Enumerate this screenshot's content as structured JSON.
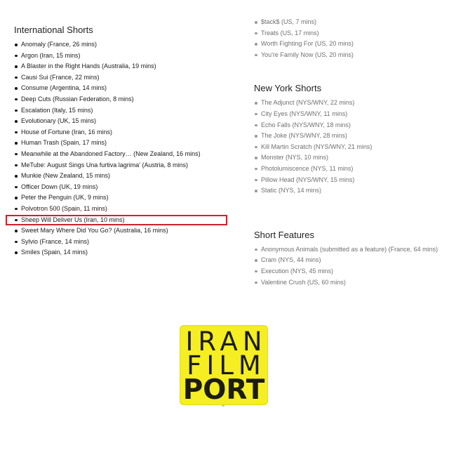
{
  "international": {
    "title": "International Shorts",
    "items": [
      "Anomaly (France, 26 mins)",
      "Argon (Iran, 15 mins)",
      "A Blaster in the Right Hands (Australia, 19 mins)",
      "Causi Sui (France, 22 mins)",
      "Consume (Argentina, 14 mins)",
      "Deep Cuts (Russian Federation, 8 mins)",
      "Escalation (Italy, 15 mins)",
      "Evolutionary (UK, 15 mins)",
      "House of Fortune (Iran, 16 mins)",
      "Human Trash (Spain, 17 mins)",
      "Meanwhile at the Abandoned Factory… (New Zealand, 16 mins)",
      "MeTube: August Sings Una furtiva lagrima' (Austria, 8 mins)",
      "Munkie (New Zealand, 15 mins)",
      "Officer Down (UK, 19 mins)",
      "Peter the Penguin (UK, 9 mins)",
      "Polvotron 500 (Spain, 11 mins)",
      "Sheep Will Deliver Us (Iran, 10 mins)",
      "Sweet Mary Where Did You Go? (Australia, 16 mins)",
      "Sylvio (France, 14 mins)",
      "Smiles  (Spain, 14 mins)"
    ]
  },
  "continued": {
    "items": [
      "$tack$ (US, 7 mins)",
      "Treats (US, 17 mins)",
      "Worth Fighting For (US, 20 mins)",
      "You're Family Now (US, 20 mins)"
    ]
  },
  "new_york": {
    "title": "New York Shorts",
    "items": [
      "The Adjunct (NYS/WNY, 22 mins)",
      "City Eyes (NYS/WNY, 11 mins)",
      "Echo Falls (NYS/WNY, 18 mins)",
      "The Joke (NYS/WNY, 28 mins)",
      "Kill Martin Scratch (NYS/WNY, 21 mins)",
      "Monster (NYS, 10 mins)",
      "Photolumiscence (NYS, 11 mins)",
      "Pillow Head (NYS/WNY, 15 mins)",
      "Static (NYS, 14 mins)"
    ]
  },
  "short_features": {
    "title": "Short Features",
    "items": [
      "Anonymous Animals (submitted as a feature) (France, 64 mins)",
      "Cram (NYS, 44 mins)",
      "Execution (NYS, 45 mins)",
      "Valentine Crush (US, 60 mins)"
    ]
  },
  "logo": {
    "line1": "IRAN",
    "line2": "FILM",
    "line3": "PORT"
  },
  "colors": {
    "logo_background": "#f4ee22",
    "highlight_border": "#d21f2a"
  }
}
